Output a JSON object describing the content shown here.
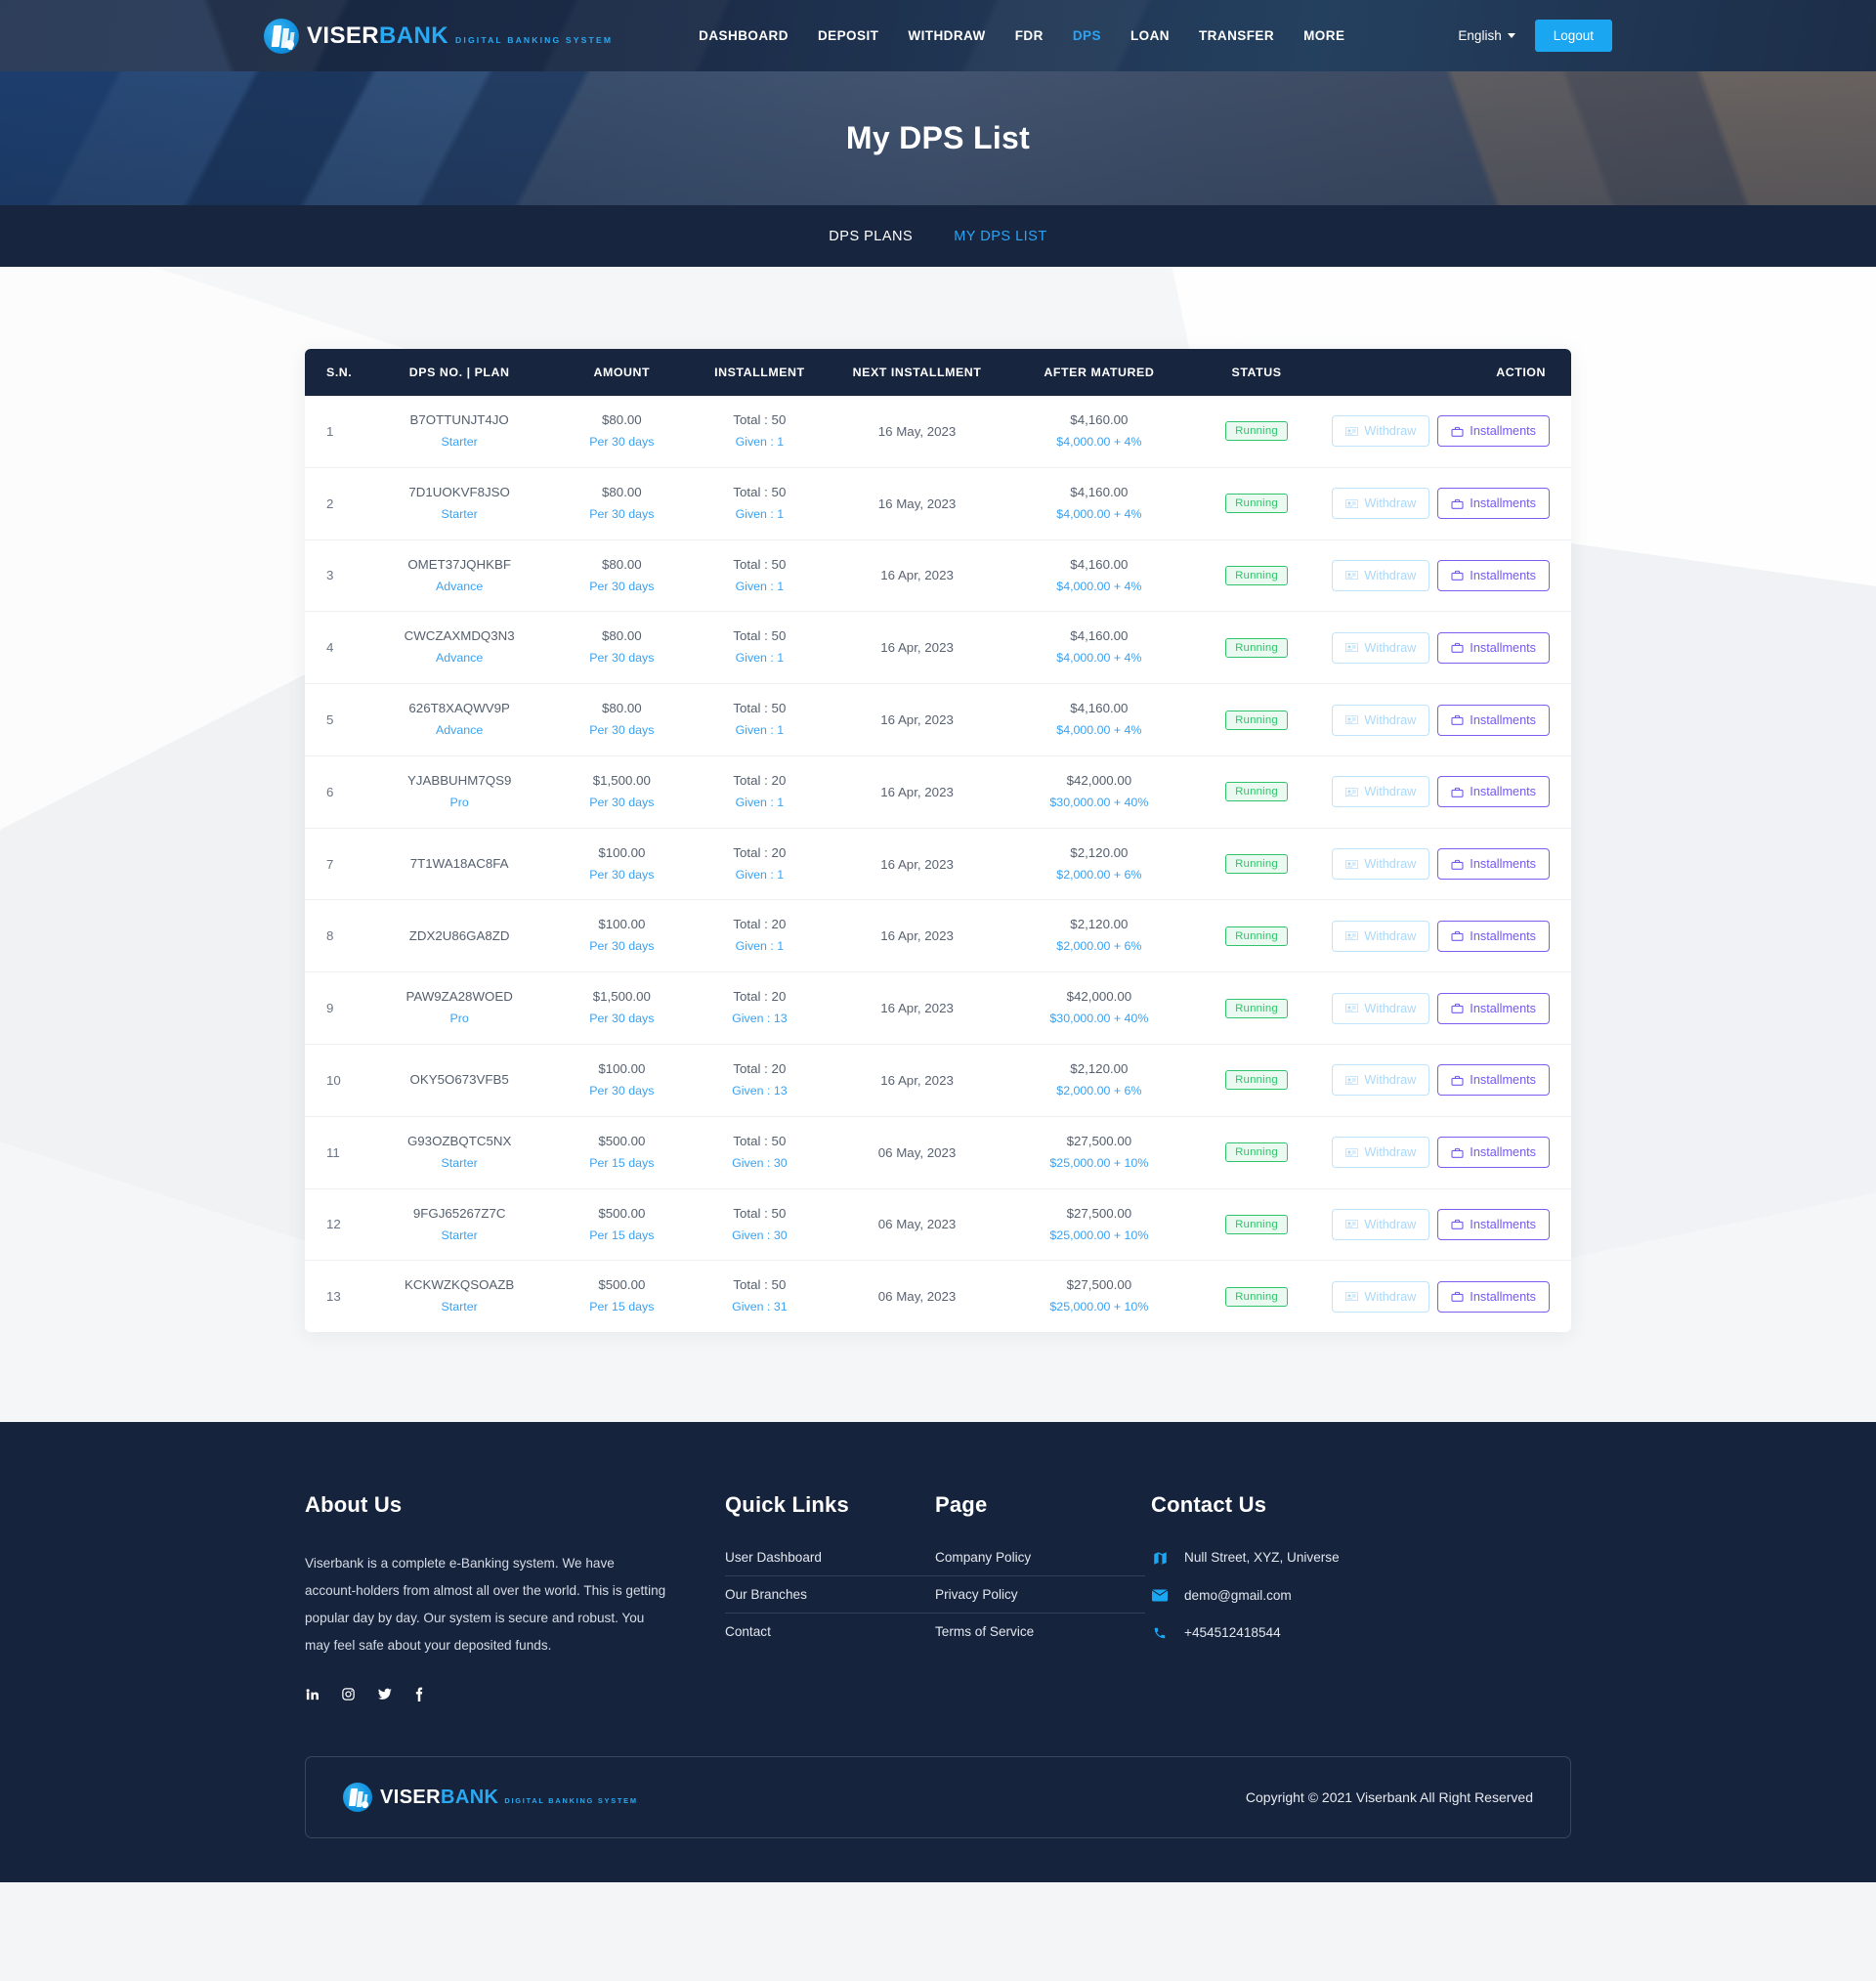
{
  "brand": {
    "name_part1": "VISER",
    "name_part2": "BANK",
    "tagline": "DIGITAL BANKING SYSTEM"
  },
  "nav": {
    "items": [
      {
        "label": "DASHBOARD",
        "active": false
      },
      {
        "label": "DEPOSIT",
        "active": false
      },
      {
        "label": "WITHDRAW",
        "active": false
      },
      {
        "label": "FDR",
        "active": false
      },
      {
        "label": "DPS",
        "active": true
      },
      {
        "label": "LOAN",
        "active": false
      },
      {
        "label": "TRANSFER",
        "active": false
      },
      {
        "label": "MORE",
        "active": false
      }
    ],
    "language": "English",
    "logout_label": "Logout"
  },
  "hero": {
    "title": "My DPS List"
  },
  "subnav": {
    "items": [
      {
        "label": "DPS PLANS",
        "active": false
      },
      {
        "label": "MY DPS LIST",
        "active": true
      }
    ]
  },
  "table": {
    "headers": [
      "S.N.",
      "DPS NO. | PLAN",
      "AMOUNT",
      "INSTALLMENT",
      "NEXT INSTALLMENT",
      "AFTER MATURED",
      "STATUS",
      "ACTION"
    ],
    "withdraw_label": "Withdraw",
    "installments_label": "Installments",
    "rows": [
      {
        "sn": "1",
        "dps_no": "B7OTTUNJT4JO",
        "plan": "Starter",
        "amount": "$80.00",
        "amount_sub": "Per 30 days",
        "inst_total": "Total : 50",
        "inst_given": "Given : 1",
        "next": "16 May, 2023",
        "matured": "$4,160.00",
        "matured_sub": "$4,000.00 + 4%",
        "status": "Running"
      },
      {
        "sn": "2",
        "dps_no": "7D1UOKVF8JSO",
        "plan": "Starter",
        "amount": "$80.00",
        "amount_sub": "Per 30 days",
        "inst_total": "Total : 50",
        "inst_given": "Given : 1",
        "next": "16 May, 2023",
        "matured": "$4,160.00",
        "matured_sub": "$4,000.00 + 4%",
        "status": "Running"
      },
      {
        "sn": "3",
        "dps_no": "OMET37JQHKBF",
        "plan": "Advance",
        "amount": "$80.00",
        "amount_sub": "Per 30 days",
        "inst_total": "Total : 50",
        "inst_given": "Given : 1",
        "next": "16 Apr, 2023",
        "matured": "$4,160.00",
        "matured_sub": "$4,000.00 + 4%",
        "status": "Running"
      },
      {
        "sn": "4",
        "dps_no": "CWCZAXMDQ3N3",
        "plan": "Advance",
        "amount": "$80.00",
        "amount_sub": "Per 30 days",
        "inst_total": "Total : 50",
        "inst_given": "Given : 1",
        "next": "16 Apr, 2023",
        "matured": "$4,160.00",
        "matured_sub": "$4,000.00 + 4%",
        "status": "Running"
      },
      {
        "sn": "5",
        "dps_no": "626T8XAQWV9P",
        "plan": "Advance",
        "amount": "$80.00",
        "amount_sub": "Per 30 days",
        "inst_total": "Total : 50",
        "inst_given": "Given : 1",
        "next": "16 Apr, 2023",
        "matured": "$4,160.00",
        "matured_sub": "$4,000.00 + 4%",
        "status": "Running"
      },
      {
        "sn": "6",
        "dps_no": "YJABBUHM7QS9",
        "plan": "Pro",
        "amount": "$1,500.00",
        "amount_sub": "Per 30 days",
        "inst_total": "Total : 20",
        "inst_given": "Given : 1",
        "next": "16 Apr, 2023",
        "matured": "$42,000.00",
        "matured_sub": "$30,000.00 + 40%",
        "status": "Running"
      },
      {
        "sn": "7",
        "dps_no": "7T1WA18AC8FA",
        "plan": "",
        "amount": "$100.00",
        "amount_sub": "Per 30 days",
        "inst_total": "Total : 20",
        "inst_given": "Given : 1",
        "next": "16 Apr, 2023",
        "matured": "$2,120.00",
        "matured_sub": "$2,000.00 + 6%",
        "status": "Running"
      },
      {
        "sn": "8",
        "dps_no": "ZDX2U86GA8ZD",
        "plan": "",
        "amount": "$100.00",
        "amount_sub": "Per 30 days",
        "inst_total": "Total : 20",
        "inst_given": "Given : 1",
        "next": "16 Apr, 2023",
        "matured": "$2,120.00",
        "matured_sub": "$2,000.00 + 6%",
        "status": "Running"
      },
      {
        "sn": "9",
        "dps_no": "PAW9ZA28WOED",
        "plan": "Pro",
        "amount": "$1,500.00",
        "amount_sub": "Per 30 days",
        "inst_total": "Total : 20",
        "inst_given": "Given : 13",
        "next": "16 Apr, 2023",
        "matured": "$42,000.00",
        "matured_sub": "$30,000.00 + 40%",
        "status": "Running"
      },
      {
        "sn": "10",
        "dps_no": "OKY5O673VFB5",
        "plan": "",
        "amount": "$100.00",
        "amount_sub": "Per 30 days",
        "inst_total": "Total : 20",
        "inst_given": "Given : 13",
        "next": "16 Apr, 2023",
        "matured": "$2,120.00",
        "matured_sub": "$2,000.00 + 6%",
        "status": "Running"
      },
      {
        "sn": "11",
        "dps_no": "G93OZBQTC5NX",
        "plan": "Starter",
        "amount": "$500.00",
        "amount_sub": "Per 15 days",
        "inst_total": "Total : 50",
        "inst_given": "Given : 30",
        "next": "06 May, 2023",
        "matured": "$27,500.00",
        "matured_sub": "$25,000.00 + 10%",
        "status": "Running"
      },
      {
        "sn": "12",
        "dps_no": "9FGJ65267Z7C",
        "plan": "Starter",
        "amount": "$500.00",
        "amount_sub": "Per 15 days",
        "inst_total": "Total : 50",
        "inst_given": "Given : 30",
        "next": "06 May, 2023",
        "matured": "$27,500.00",
        "matured_sub": "$25,000.00 + 10%",
        "status": "Running"
      },
      {
        "sn": "13",
        "dps_no": "KCKWZKQSOAZB",
        "plan": "Starter",
        "amount": "$500.00",
        "amount_sub": "Per 15 days",
        "inst_total": "Total : 50",
        "inst_given": "Given : 31",
        "next": "06 May, 2023",
        "matured": "$27,500.00",
        "matured_sub": "$25,000.00 + 10%",
        "status": "Running"
      }
    ]
  },
  "footer": {
    "about": {
      "title": "About Us",
      "text": "Viserbank is a complete e-Banking system. We have account-holders from almost all over the world. This is getting popular day by day. Our system is secure and robust. You may feel safe about your deposited funds.",
      "socials": [
        "linkedin-icon",
        "instagram-icon",
        "twitter-icon",
        "facebook-icon"
      ]
    },
    "quick_links": {
      "title": "Quick Links",
      "items": [
        "User Dashboard",
        "Our Branches",
        "Contact"
      ]
    },
    "page": {
      "title": "Page",
      "items": [
        "Company Policy",
        "Privacy Policy",
        "Terms of Service"
      ]
    },
    "contact": {
      "title": "Contact Us",
      "address": "Null Street, XYZ, Universe",
      "email": "demo@gmail.com",
      "phone": "+454512418544"
    },
    "copyright": "Copyright © 2021 Viserbank All Right Reserved"
  },
  "colors": {
    "accent": "#1aa6f0",
    "dark": "#16233c",
    "status_running": "#2fc46b",
    "installments": "#7559ee"
  }
}
